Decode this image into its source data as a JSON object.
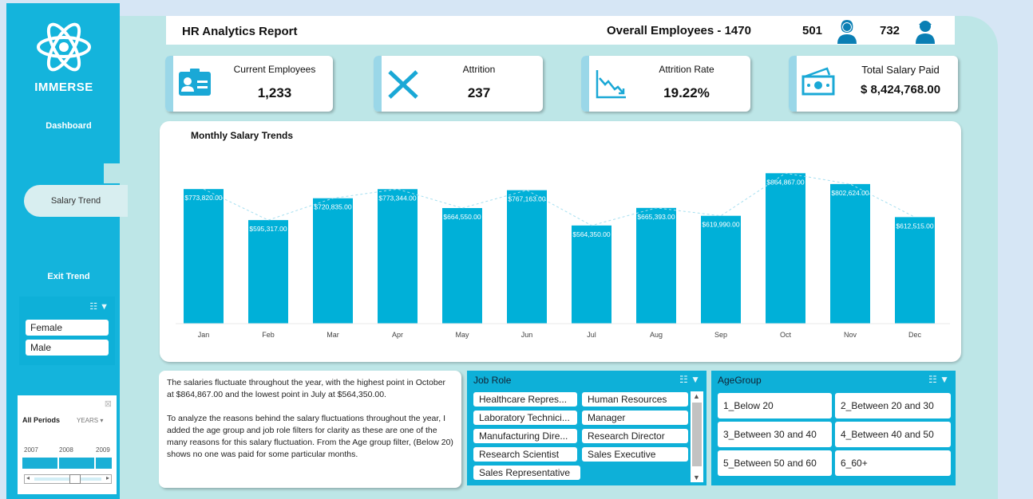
{
  "brand": {
    "name": "IMMERSE"
  },
  "nav": {
    "dashboard": "Dashboard",
    "salary_trend": "Salary Trend",
    "exit_trend": "Exit Trend"
  },
  "header": {
    "title": "HR Analytics Report",
    "overall": "Overall Employees - 1470",
    "female_count": "501",
    "male_count": "732"
  },
  "kpis": [
    {
      "label": "Current Employees",
      "value": "1,233"
    },
    {
      "label": "Attrition",
      "value": "237"
    },
    {
      "label": "Attrition Rate",
      "value": "19.22%"
    },
    {
      "label": "Total Salary Paid",
      "value": "$ 8,424,768.00"
    }
  ],
  "chart_data": {
    "type": "bar",
    "title": "Monthly Salary Trends",
    "categories": [
      "Jan",
      "Feb",
      "Mar",
      "Apr",
      "May",
      "Jun",
      "Jul",
      "Aug",
      "Sep",
      "Oct",
      "Nov",
      "Dec"
    ],
    "values": [
      773820,
      595317,
      720835,
      773344,
      664550,
      767163,
      564350,
      665393,
      619990,
      864867,
      802624,
      612515
    ],
    "data_labels": [
      "$773,820.00",
      "$595,317.00",
      "$720,835.00",
      "$773,344.00",
      "$664,550.00",
      "$767,163.00",
      "$564,350.00",
      "$665,393.00",
      "$619,990.00",
      "$864,867.00",
      "$802,624.00",
      "$612,515.00"
    ],
    "trendline": "dashed",
    "grid": false,
    "color": "#00b0d8"
  },
  "analysis": {
    "p1": "The salaries fluctuate throughout the year, with the highest point in October at $864,867.00 and the lowest point in July at $564,350.00.",
    "p2": "To analyze the reasons behind the salary fluctuations throughout the year, I added the age group and job role filters for clarity as these are one of the many reasons for this salary fluctuation. From the Age group filter, (Below 20) shows no one was paid for some particular months."
  },
  "gender_slicer": {
    "items": [
      "Female",
      "Male"
    ]
  },
  "timeline": {
    "label": "All Periods",
    "unit": "YEARS",
    "years": [
      "2007",
      "2008",
      "2009"
    ]
  },
  "job_role_slicer": {
    "title": "Job Role",
    "items": [
      "Healthcare Repres...",
      "Human Resources",
      "Laboratory Technici...",
      "Manager",
      "Manufacturing Dire...",
      "Research Director",
      "Research Scientist",
      "Sales Executive",
      "Sales Representative"
    ]
  },
  "age_group_slicer": {
    "title": "AgeGroup",
    "items": [
      "1_Below 20",
      "2_Between 20 and 30",
      "3_Between 30 and 40",
      "4_Between 40 and 50",
      "5_Between 50 and 60",
      "6_60+"
    ]
  },
  "colors": {
    "accent": "#14b4dc",
    "panel": "#bde6e7",
    "bar": "#00b0d8"
  }
}
